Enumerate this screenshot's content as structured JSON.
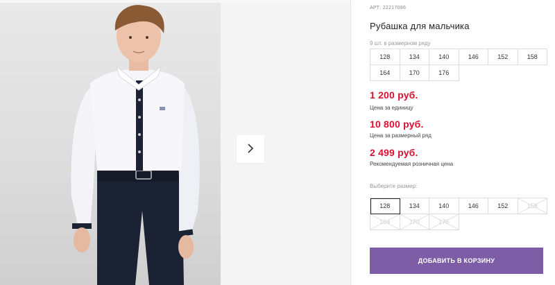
{
  "gallery": {
    "next_icon": "chevron-right-icon"
  },
  "product": {
    "article": "АРТ: 22217086",
    "title": "Рубашка для мальчика",
    "qty_note": "9 шт. в размерном ряду",
    "size_range": [
      "128",
      "134",
      "140",
      "146",
      "152",
      "158",
      "164",
      "170",
      "176"
    ]
  },
  "prices": {
    "unit_price": "1 200 руб.",
    "unit_label": "Цена за единицу",
    "range_price": "10 800 руб.",
    "range_label": "Цена за размерный ряд",
    "retail_price": "2 499 руб.",
    "retail_label": "Рекомендуемая розничная цена",
    "price_color": "#d8102f"
  },
  "size_select": {
    "label": "Выберите размер:",
    "selected": "128",
    "available": [
      "128",
      "134",
      "140",
      "146",
      "152"
    ],
    "unavailable": [
      "158",
      "164",
      "170",
      "176"
    ]
  },
  "cart": {
    "button_label": "ДОБАВИТЬ В КОРЗИНУ",
    "accent_color": "#7d5ea6"
  }
}
